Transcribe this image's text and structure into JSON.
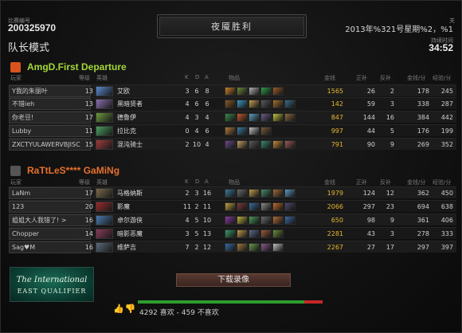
{
  "header": {
    "match_id_label": "比赛编号",
    "match_id": "200325970",
    "game_mode": "队长模式",
    "result_banner": "夜魇胜利",
    "date": "2013年%321号星期%2，%1",
    "close_label": "关",
    "duration_label": "持续时间",
    "duration": "34:52"
  },
  "columns": {
    "player": "玩家",
    "level": "等级",
    "hero": "英雄",
    "k": "K",
    "d": "D",
    "a": "A",
    "items": "物品",
    "gold": "金钱",
    "last_hits": "正补",
    "denies": "反补",
    "gpm": "金钱/分",
    "xpm": "经验/分"
  },
  "teams": [
    {
      "name": "AmgD.First Departure",
      "color": "#a4d836",
      "logo_color": "#d9531e",
      "players": [
        {
          "player": "Y我的朱丽叶",
          "level": "13",
          "hero": "艾欧",
          "k": "3",
          "d": "6",
          "a": "8",
          "gold": "1565",
          "last_hits": "26",
          "denies": "2",
          "gpm": "178",
          "xpm": "245",
          "hero_color": "#5a8ad0",
          "items": [
            "#c9822a",
            "#6a8a3a",
            "#b0b0b0",
            "#2f9a4a",
            "#9a5a2a"
          ]
        },
        {
          "player": "不错ieh",
          "level": "13",
          "hero": "黑暗贤者",
          "k": "4",
          "d": "6",
          "a": "6",
          "gold": "142",
          "last_hits": "59",
          "denies": "3",
          "gpm": "338",
          "xpm": "287",
          "hero_color": "#8a70b0",
          "items": [
            "#8a5a2a",
            "#3a9ac0",
            "#c0a050",
            "#5a5a5a",
            "#a0702a",
            "#3a6a8a"
          ]
        },
        {
          "player": "你老豆!",
          "level": "17",
          "hero": "德鲁伊",
          "k": "4",
          "d": "3",
          "a": "4",
          "gold": "847",
          "last_hits": "144",
          "denies": "16",
          "gpm": "384",
          "xpm": "442",
          "hero_color": "#6a9a3a",
          "items": [
            "#3a8a4a",
            "#c05a2a",
            "#5aa0c0",
            "#6a5a8a",
            "#c0c040",
            "#8a6a3a"
          ]
        },
        {
          "player": "Lubby",
          "level": "11",
          "hero": "拉比克",
          "k": "0",
          "d": "4",
          "a": "6",
          "gold": "997",
          "last_hits": "44",
          "denies": "5",
          "gpm": "176",
          "xpm": "199",
          "hero_color": "#4aa060",
          "items": [
            "#b07a3a",
            "#3a7aa0",
            "#c0c0c0",
            "#7a5a3a"
          ]
        },
        {
          "player": "ZXCTYULAWERVBJISC",
          "level": "15",
          "hero": "混沌骑士",
          "k": "2",
          "d": "10",
          "a": "4",
          "gold": "791",
          "last_hits": "90",
          "denies": "9",
          "gpm": "269",
          "xpm": "352",
          "hero_color": "#a03a3a",
          "items": [
            "#6a4a8a",
            "#c0a060",
            "#5a5a5a",
            "#3a8a6a",
            "#c08a3a",
            "#9a5a5a"
          ]
        }
      ]
    },
    {
      "name": "RaTtLeS**** GaMiNg",
      "color": "#e8702c",
      "logo_color": "#555555",
      "players": [
        {
          "player": "LaNm",
          "level": "17",
          "hero": "马格纳斯",
          "k": "2",
          "d": "3",
          "a": "16",
          "gold": "1979",
          "last_hits": "124",
          "denies": "12",
          "gpm": "362",
          "xpm": "450",
          "hero_color": "#7a6a4a",
          "items": [
            "#3a7a9a",
            "#6a6a6a",
            "#c09a4a",
            "#4a8a6a",
            "#9a6a3a",
            "#5a9ac0"
          ]
        },
        {
          "player": "123",
          "level": "20",
          "hero": "影魔",
          "k": "11",
          "d": "2",
          "a": "11",
          "gold": "2066",
          "last_hits": "297",
          "denies": "23",
          "gpm": "694",
          "xpm": "638",
          "hero_color": "#9a2a2a",
          "items": [
            "#c0a040",
            "#7a3a3a",
            "#3a6a9a",
            "#8a8a8a",
            "#c06a2a",
            "#4a4a6a"
          ]
        },
        {
          "player": "姐姐大人我错了! >",
          "level": "16",
          "hero": "卓尔游侠",
          "k": "4",
          "d": "5",
          "a": "10",
          "gold": "650",
          "last_hits": "98",
          "denies": "9",
          "gpm": "361",
          "xpm": "406",
          "hero_color": "#4a7ab0",
          "items": [
            "#8a3aa0",
            "#c0b040",
            "#4a9a5a",
            "#6a6a6a",
            "#b06a3a",
            "#3a6aa0"
          ]
        },
        {
          "player": "Chopper",
          "level": "14",
          "hero": "暗影恶魔",
          "k": "3",
          "d": "5",
          "a": "13",
          "gold": "2281",
          "last_hits": "43",
          "denies": "3",
          "gpm": "278",
          "xpm": "333",
          "hero_color": "#8a3a5a",
          "items": [
            "#3a9a6a",
            "#c09a4a",
            "#5a6a8a",
            "#9a5a3a",
            "#6a8a3a"
          ]
        },
        {
          "player": "Sag♥M",
          "level": "16",
          "hero": "维萨吉",
          "k": "7",
          "d": "2",
          "a": "12",
          "gold": "2267",
          "last_hits": "27",
          "denies": "17",
          "gpm": "297",
          "xpm": "397",
          "hero_color": "#5a6a7a",
          "items": [
            "#3a6aa0",
            "#a07a3a",
            "#6a9a4a",
            "#8a5a8a",
            "#c0c0c0"
          ]
        }
      ]
    }
  ],
  "actions": {
    "download_replay": "下载录像"
  },
  "branding": {
    "ti_title": "The International",
    "ti_sub": "EAST QUALIFIER"
  },
  "rating": {
    "text": "4292 喜欢 - 459 不喜欢",
    "like_fraction": 0.903
  }
}
